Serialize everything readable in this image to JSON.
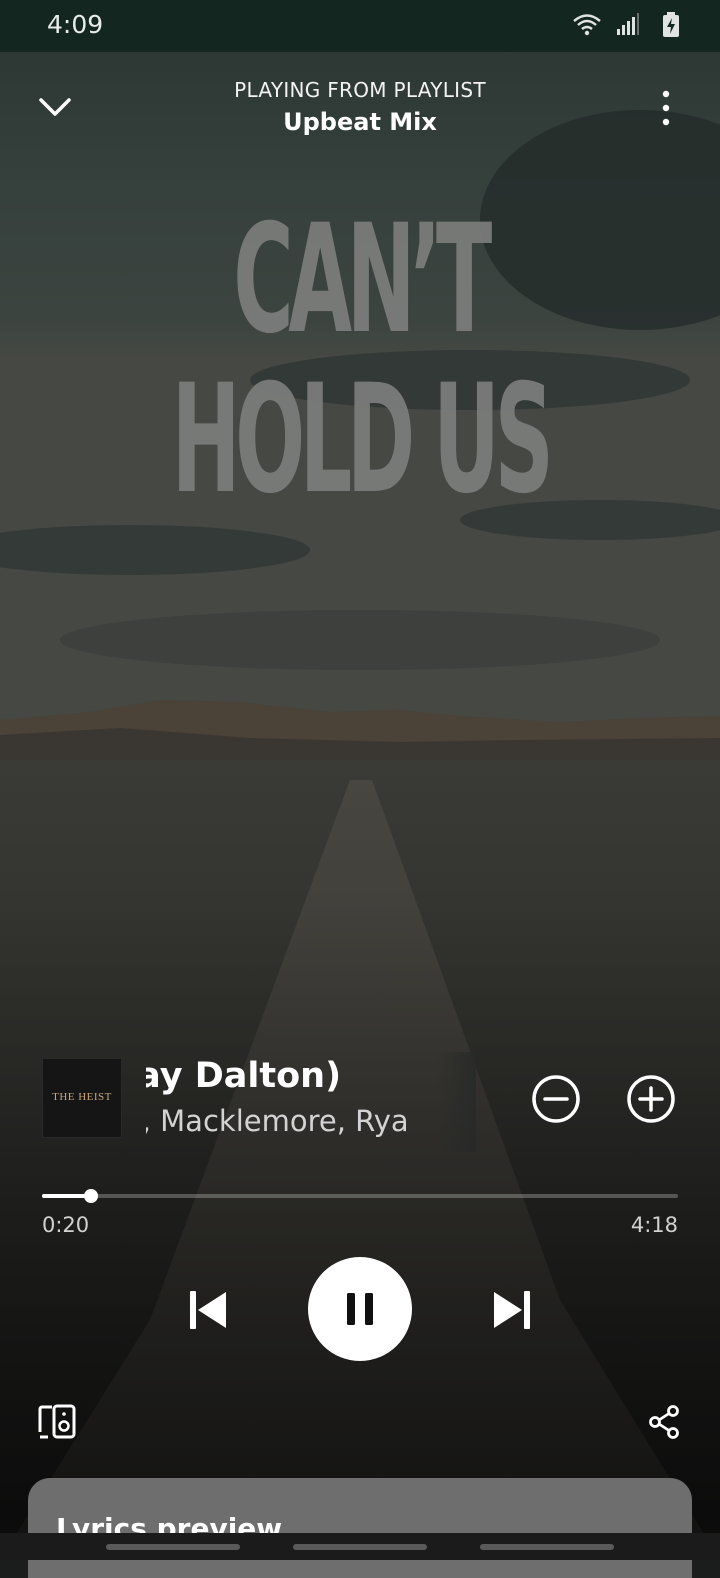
{
  "status_bar": {
    "time": "4:09",
    "icons": [
      "wifi-icon",
      "signal-icon",
      "battery-charging-icon"
    ]
  },
  "header": {
    "context_label": "PLAYING FROM PLAYLIST",
    "playlist_name": "Upbeat Mix",
    "collapse_icon": "chevron-down-icon",
    "more_icon": "more-vertical-icon"
  },
  "canvas": {
    "title_text": "CAN’T HOLD US"
  },
  "album_art": {
    "text": "THE HEIST"
  },
  "track": {
    "title_visible": "t. Ray Dalton)",
    "artists_visible": "ewis, Macklemore, Rya",
    "remove_icon": "minus-circle-icon",
    "add_icon": "plus-circle-icon"
  },
  "progress": {
    "elapsed": "0:20",
    "total": "4:18",
    "fraction": 0.0775
  },
  "controls": {
    "previous_icon": "skip-previous-icon",
    "play_pause_icon": "pause-icon",
    "next_icon": "skip-next-icon",
    "devices_icon": "connect-devices-icon",
    "share_icon": "share-icon"
  },
  "lyrics": {
    "title": "Lyrics preview"
  },
  "colors": {
    "status_bar_bg": "#142620",
    "lyrics_card_bg": "#6e6e6e",
    "accent_white": "#ffffff"
  }
}
